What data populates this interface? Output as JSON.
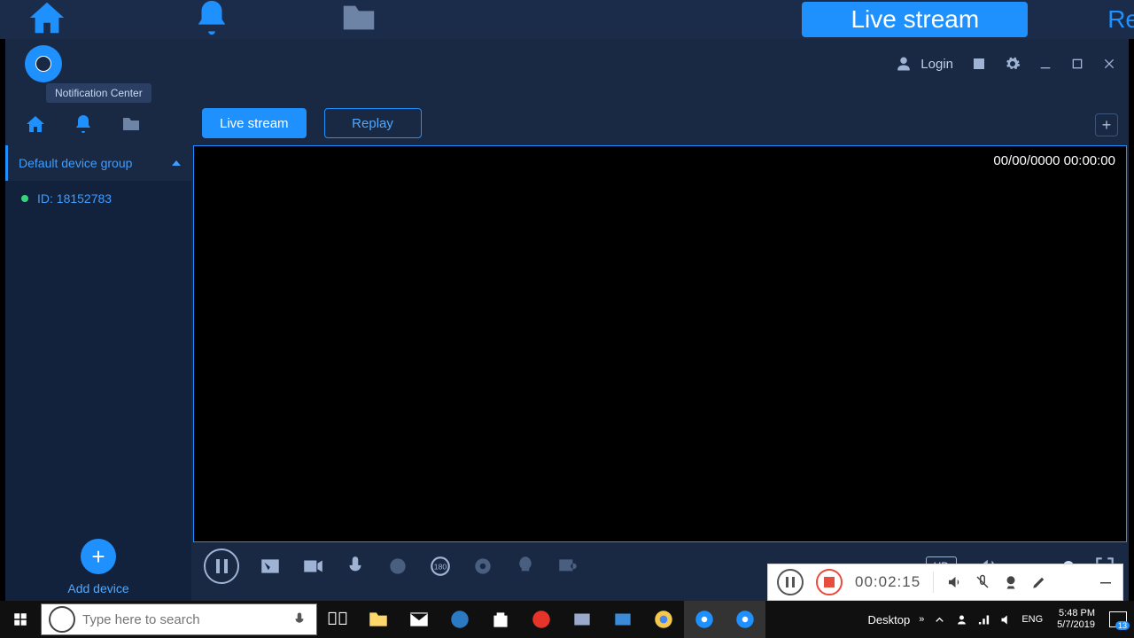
{
  "top_strip": {
    "active_tab": "Live stream",
    "ghost_tab": "Re"
  },
  "titlebar": {
    "tooltip": "Notification Center",
    "login_label": "Login"
  },
  "tabs": {
    "live": "Live stream",
    "replay": "Replay"
  },
  "sidebar": {
    "group_name": "Default device group",
    "device_label": "ID: 18152783",
    "add_device_label": "Add device"
  },
  "video": {
    "timestamp": "00/00/0000 00:00:00"
  },
  "controls": {
    "quality": "HD"
  },
  "recorder": {
    "elapsed": "00:02:15"
  },
  "taskbar": {
    "search_placeholder": "Type here to search",
    "desktop_label": "Desktop",
    "lang": "ENG",
    "time": "5:48 PM",
    "date": "5/7/2019",
    "notif_count": "13"
  }
}
